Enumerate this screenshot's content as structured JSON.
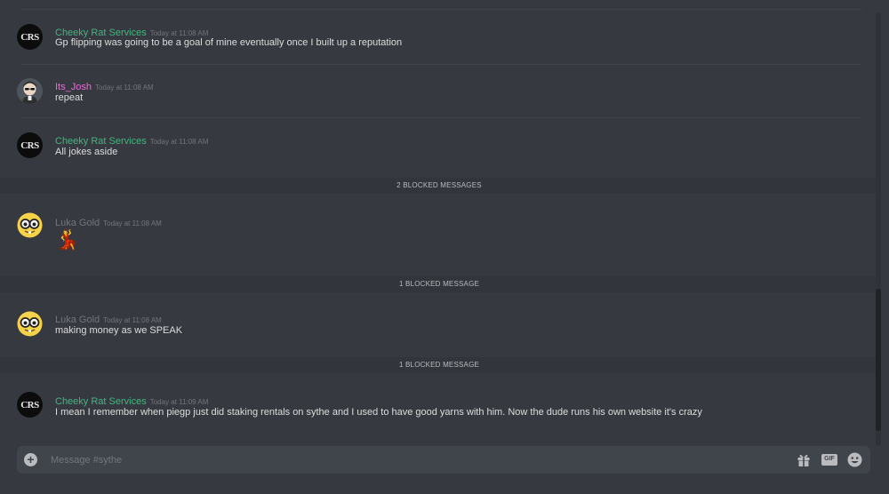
{
  "channel": {
    "placeholder": "Message #sythe"
  },
  "messages": [
    {
      "author": "Cheeky Rat Services",
      "avatar_text": "CRS",
      "time": "Today at 11:08 AM",
      "text": "Gp flipping was going to be a goal of mine eventually once I built up a reputation"
    },
    {
      "author": "Its_Josh",
      "time": "Today at 11:08 AM",
      "text": "repeat"
    },
    {
      "author": "Cheeky Rat Services",
      "avatar_text": "CRS",
      "time": "Today at 11:08 AM",
      "text": "All jokes aside"
    },
    {
      "author": "Luka Gold",
      "time": "Today at 11:08 AM",
      "text": "💃"
    },
    {
      "author": "Luka Gold",
      "time": "Today at 11:08 AM",
      "text": "making money as we SPEAK"
    },
    {
      "author": "Cheeky Rat Services",
      "avatar_text": "CRS",
      "time": "Today at 11:09 AM",
      "text": "I mean I remember when piegp just did staking rentals on sythe and I used to have good yarns with him. Now the dude runs his own website it's crazy"
    }
  ],
  "blocked": [
    {
      "label": "2 BLOCKED MESSAGES"
    },
    {
      "label": "1 BLOCKED MESSAGE"
    },
    {
      "label": "1 BLOCKED MESSAGE"
    }
  ],
  "colors": {
    "background": "#36393f",
    "cheeky_name": "#43b581",
    "josh_name": "#e86bd8",
    "luka_name": "#72767d",
    "composer": "#40444b"
  },
  "icons": {
    "composer_add": "plus-circle-icon",
    "gift": "gift-icon",
    "gif": "gif-icon",
    "emoji": "smiley-emoji-icon",
    "gif_label": "GIF"
  }
}
